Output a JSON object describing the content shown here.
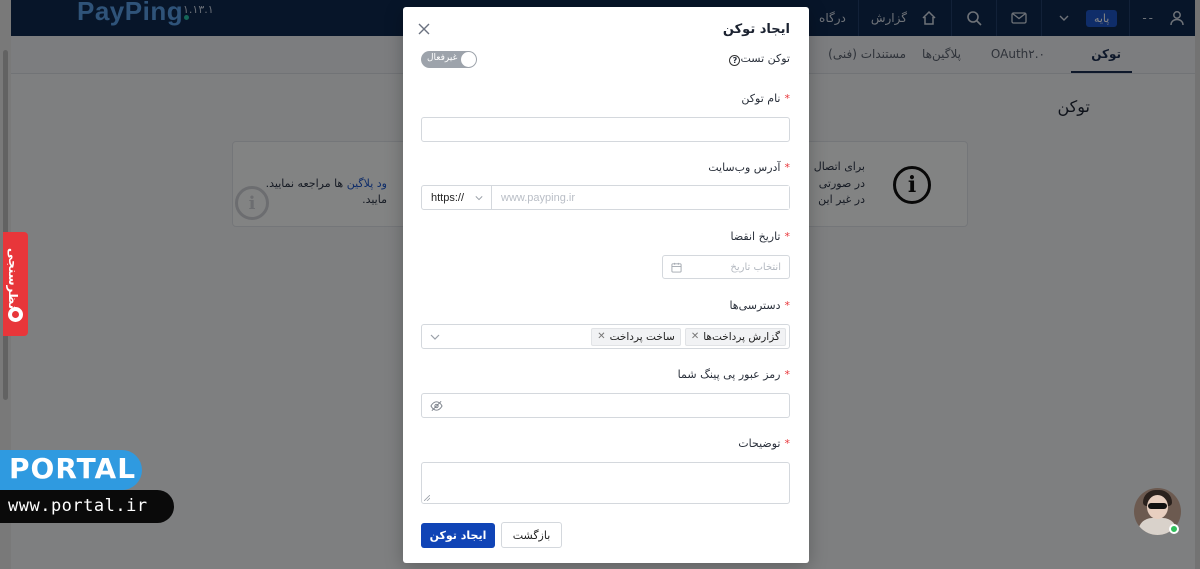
{
  "app": {
    "logo": "PayPing",
    "version": "۱.۱۳.۱",
    "topbar": {
      "items": [
        "درگاه",
        "گزارش"
      ],
      "plan_badge": "پایه",
      "user_dashes": "--"
    },
    "tabs": [
      {
        "label": "توکن",
        "active": true
      },
      {
        "label": "OAuth۲.۰",
        "active": false
      },
      {
        "label": "پلاگین‌ها",
        "active": false
      },
      {
        "label": "مستندات (فنی)",
        "active": false
      }
    ],
    "page_title": "توکن",
    "info": {
      "line1": "برای اتصال",
      "line2_prefix": "در صورتی ",
      "line2_link": "ود پلاگین",
      "line2_suffix": " ها مراجعه نمایید.",
      "line3": "در غیر این",
      "line3_suffix": "مایید."
    }
  },
  "modal": {
    "title": "ایجاد توکن",
    "test_token": {
      "label": "توکن تست",
      "help": "?",
      "toggle_label": "غیرفعال",
      "enabled": false
    },
    "fields": {
      "token_name": {
        "label": "نام توکن",
        "value": ""
      },
      "website": {
        "label": "آدرس وب‌سایت",
        "protocol": "https://",
        "placeholder": "www.payping.ir",
        "value": ""
      },
      "expire_date": {
        "label": "تاریخ انقضا",
        "placeholder": "انتخاب تاریخ"
      },
      "permissions": {
        "label": "دسترسی‌ها",
        "tags": [
          "گزارش پرداخت‌ها",
          "ساخت پرداخت"
        ]
      },
      "password": {
        "label": "رمز عبور پی پینگ شما",
        "value": ""
      },
      "description": {
        "label": "توضیحات",
        "value": ""
      }
    },
    "buttons": {
      "submit": "ایجاد توکن",
      "back": "بازگشت"
    }
  },
  "side": {
    "survey": "نظرسنجی",
    "watermark_word": "PORTAL",
    "watermark_url": "www.portal.ir"
  },
  "colors": {
    "primary": "#1044b6",
    "navy": "#0f2a4f",
    "required": "#e8363a",
    "overlay": "rgba(0,0,0,0.48)"
  }
}
